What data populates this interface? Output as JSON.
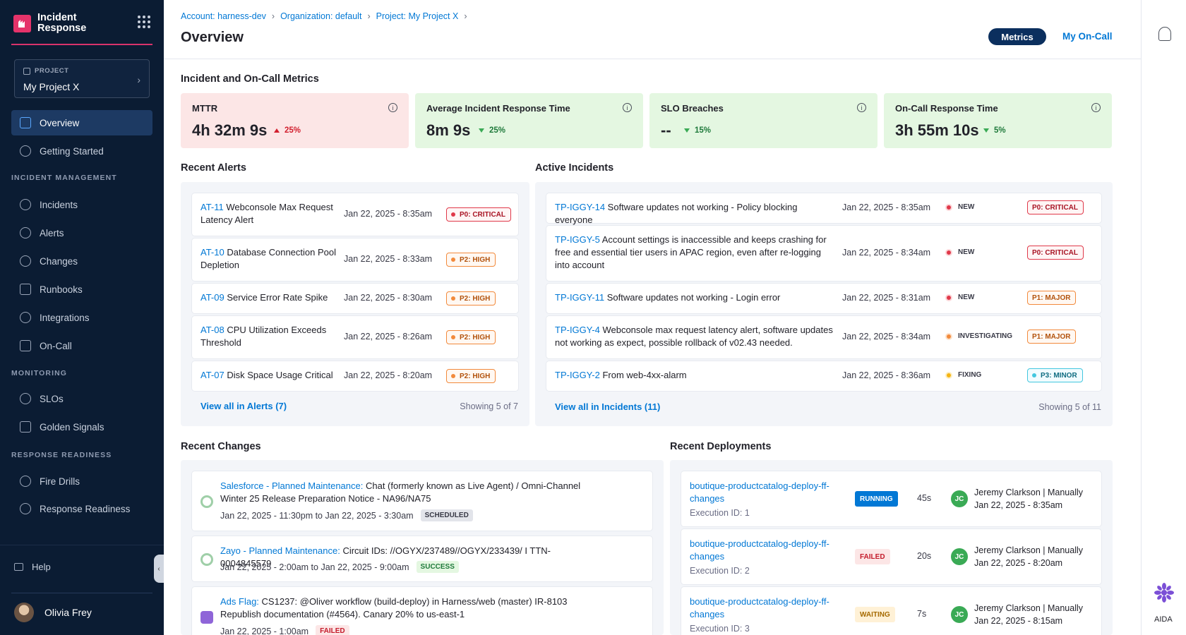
{
  "app": {
    "title_line1": "Incident",
    "title_line2": "Response"
  },
  "project": {
    "tag": "PROJECT",
    "name": "My Project X"
  },
  "sidebar": {
    "items": [
      {
        "label": "Overview"
      },
      {
        "label": "Getting Started"
      },
      {
        "label": "Incidents"
      },
      {
        "label": "Alerts"
      },
      {
        "label": "Changes"
      },
      {
        "label": "Runbooks"
      },
      {
        "label": "Integrations"
      },
      {
        "label": "On-Call"
      },
      {
        "label": "SLOs"
      },
      {
        "label": "Golden Signals"
      },
      {
        "label": "Fire Drills"
      },
      {
        "label": "Response Readiness"
      }
    ],
    "sections": {
      "incident_management": "INCIDENT MANAGEMENT",
      "monitoring": "MONITORING",
      "response_readiness": "RESPONSE READINESS"
    },
    "help": "Help",
    "user": "Olivia Frey"
  },
  "breadcrumb": {
    "account": "Account: harness-dev",
    "org": "Organization: default",
    "project": "Project: My Project X"
  },
  "header": {
    "title": "Overview",
    "tab_metrics": "Metrics",
    "tab_oncall": "My On-Call"
  },
  "rail": {
    "aida": "AIDA"
  },
  "metrics": {
    "title": "Incident and On-Call Metrics",
    "cards": [
      {
        "label": "MTTR",
        "value": "4h 32m 9s",
        "delta": "25%",
        "direction": "up"
      },
      {
        "label": "Average Incident Response Time",
        "value": "8m 9s",
        "delta": "25%",
        "direction": "down"
      },
      {
        "label": "SLO Breaches",
        "value": "--",
        "delta": "15%",
        "direction": "down"
      },
      {
        "label": "On-Call Response Time",
        "value": "3h 55m 10s",
        "delta": "5%",
        "direction": "down"
      }
    ]
  },
  "alerts": {
    "title": "Recent Alerts",
    "rows": [
      {
        "id": "AT-11",
        "desc": "Webconsole Max Request Latency Alert",
        "time": "Jan 22, 2025 - 8:35am",
        "severity": "P0: CRITICAL"
      },
      {
        "id": "AT-10",
        "desc": "Database Connection Pool Depletion",
        "time": "Jan 22, 2025 - 8:33am",
        "severity": "P2: HIGH"
      },
      {
        "id": "AT-09",
        "desc": "Service Error Rate Spike",
        "time": "Jan 22, 2025 - 8:30am",
        "severity": "P2: HIGH"
      },
      {
        "id": "AT-08",
        "desc": "CPU Utilization Exceeds Threshold",
        "time": "Jan 22, 2025 - 8:26am",
        "severity": "P2: HIGH"
      },
      {
        "id": "AT-07",
        "desc": "Disk Space Usage Critical",
        "time": "Jan 22, 2025 - 8:20am",
        "severity": "P2: HIGH"
      }
    ],
    "view_all": "View all in Alerts (7)",
    "showing": "Showing 5 of 7"
  },
  "incidents": {
    "title": "Active Incidents",
    "rows": [
      {
        "id": "TP-IGGY-14",
        "desc": "Software updates not working - Policy blocking everyone",
        "time": "Jan 22, 2025 - 8:35am",
        "status": "NEW",
        "severity": "P0: CRITICAL"
      },
      {
        "id": "TP-IGGY-5",
        "desc": "Account settings is inaccessible and keeps crashing for free and essential tier users in APAC region, even after re-logging into account",
        "time": "Jan 22, 2025 - 8:34am",
        "status": "NEW",
        "severity": "P0: CRITICAL"
      },
      {
        "id": "TP-IGGY-11",
        "desc": "Software updates not working - Login error",
        "time": "Jan 22, 2025 - 8:31am",
        "status": "NEW",
        "severity": "P1: MAJOR"
      },
      {
        "id": "TP-IGGY-4",
        "desc": "Webconsole max request latency alert, software updates not working as expect, possible rollback of v02.43 needed.",
        "time": "Jan 22, 2025 - 8:34am",
        "status": "INVESTIGATING",
        "severity": "P1: MAJOR"
      },
      {
        "id": "TP-IGGY-2",
        "desc": "From web-4xx-alarm",
        "time": "Jan 22, 2025 - 8:36am",
        "status": "FIXING",
        "severity": "P3: MINOR"
      }
    ],
    "view_all": "View all in Incidents (11)",
    "showing": "Showing 5 of 11"
  },
  "changes": {
    "title": "Recent Changes",
    "rows": [
      {
        "source": "Salesforce - Planned Maintenance:",
        "desc": "Chat (formerly known as Live Agent) / Omni-Channel Winter 25 Release Preparation Notice - NA96/NA75",
        "time": "Jan 22, 2025 - 11:30pm to Jan 22, 2025 - 3:30am",
        "status": "SCHEDULED"
      },
      {
        "source": "Zayo - Planned Maintenance:",
        "desc": "Circuit IDs: //OGYX/237489//OGYX/233439/ I TTN-0004845579",
        "time": "Jan 22, 2025 - 2:00am to Jan 22, 2025 - 9:00am",
        "status": "SUCCESS"
      },
      {
        "source": "Ads Flag:",
        "desc": "CS1237: @Oliver workflow (build-deploy) in Harness/web (master) IR-8103 Republish documentation (#4564). Canary 20% to us-east-1",
        "time": "Jan 22, 2025 - 1:00am",
        "status": "FAILED"
      }
    ]
  },
  "deployments": {
    "title": "Recent Deployments",
    "rows": [
      {
        "name": "boutique-productcatalog-deploy-ff-changes",
        "exec": "Execution ID: 1",
        "status": "RUNNING",
        "duration": "45s",
        "initials": "JC",
        "user": "Jeremy Clarkson | Manually",
        "time": "Jan 22, 2025 - 8:35am"
      },
      {
        "name": "boutique-productcatalog-deploy-ff-changes",
        "exec": "Execution ID: 2",
        "status": "FAILED",
        "duration": "20s",
        "initials": "JC",
        "user": "Jeremy Clarkson | Manually",
        "time": "Jan 22, 2025 - 8:20am"
      },
      {
        "name": "boutique-productcatalog-deploy-ff-changes",
        "exec": "Execution ID: 3",
        "status": "WAITING",
        "duration": "7s",
        "initials": "JC",
        "user": "Jeremy Clarkson | Manually",
        "time": "Jan 22, 2025 - 8:15am"
      }
    ]
  }
}
